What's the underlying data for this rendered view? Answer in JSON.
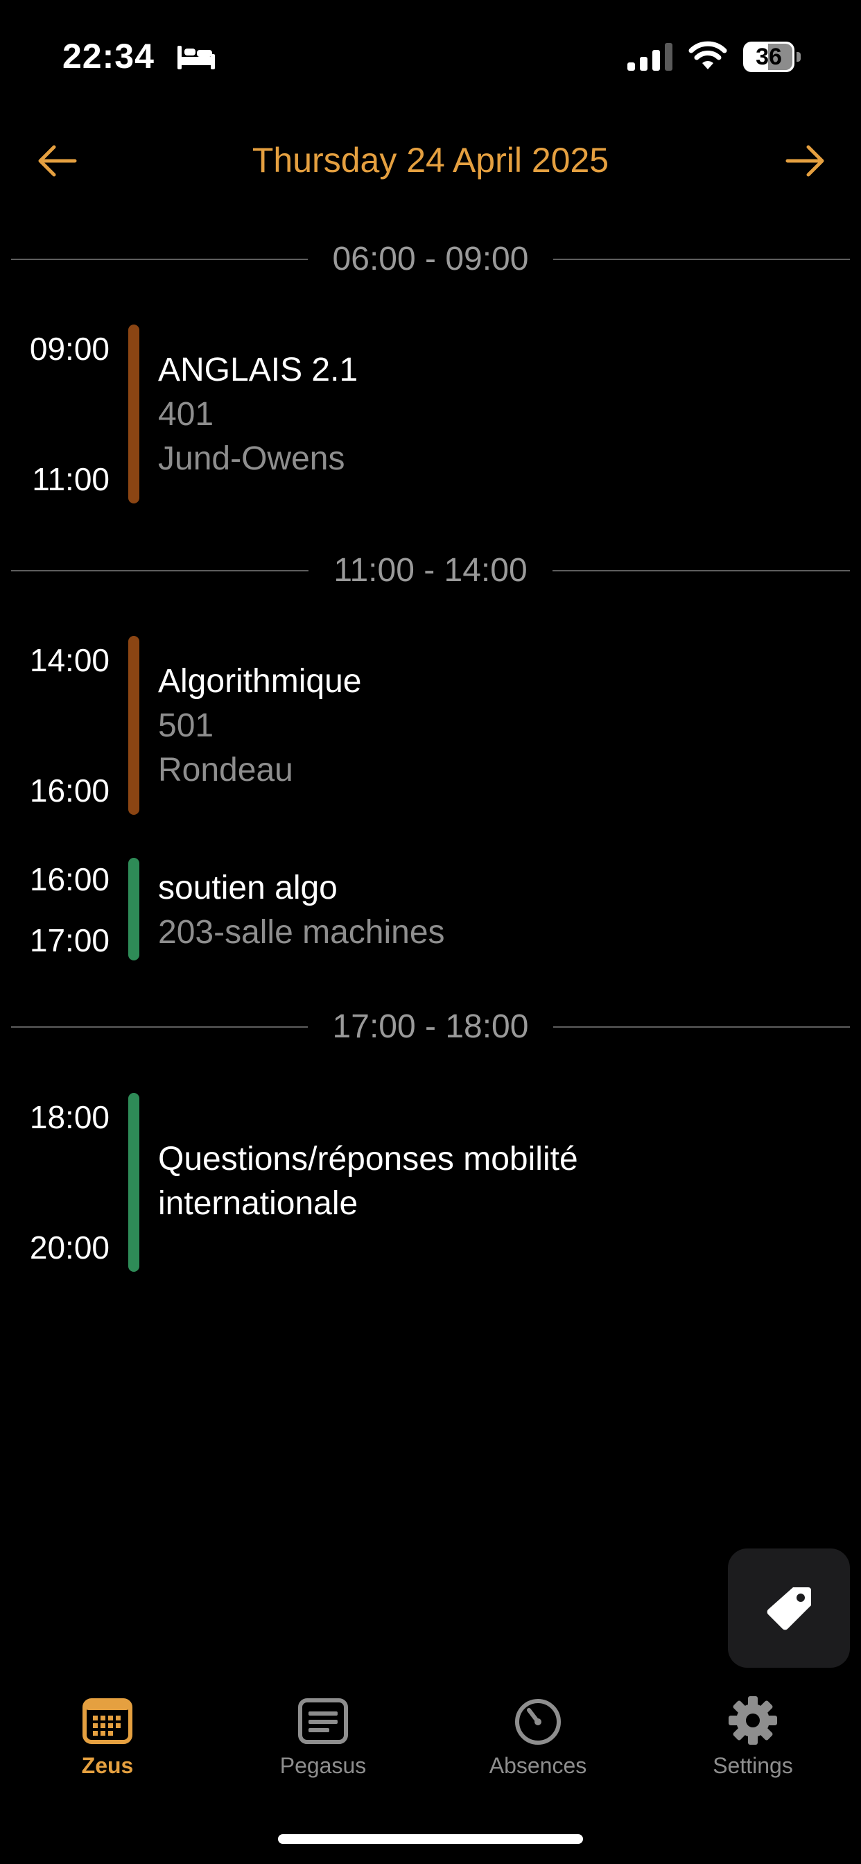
{
  "status_bar": {
    "time": "22:34",
    "battery_level": "36",
    "icons": [
      "bed-icon",
      "signal-icon",
      "wifi-icon",
      "battery-icon"
    ]
  },
  "header": {
    "date": "Thursday 24 April 2025",
    "prev_icon": "arrow-left-icon",
    "next_icon": "arrow-right-icon",
    "accent_color": "#E5A040"
  },
  "schedule": {
    "separators": [
      {
        "label": "06:00 - 09:00"
      },
      {
        "label": "11:00 - 14:00"
      },
      {
        "label": "17:00 - 18:00"
      }
    ],
    "events": [
      {
        "start": "09:00",
        "end": "11:00",
        "title": "ANGLAIS 2.1",
        "room": "401",
        "teacher": "Jund-Owens",
        "color": "#8B4513"
      },
      {
        "start": "14:00",
        "end": "16:00",
        "title": "Algorithmique",
        "room": "501",
        "teacher": "Rondeau",
        "color": "#8B4513"
      },
      {
        "start": "16:00",
        "end": "17:00",
        "title": "soutien algo",
        "room": "203-salle machines",
        "color": "#2E8B57"
      },
      {
        "start": "18:00",
        "end": "20:00",
        "title_line1": "Questions/réponses mobilité",
        "title_line2": "internationale",
        "color": "#2E8B57"
      }
    ]
  },
  "fab": {
    "icon": "tag-icon"
  },
  "tab_bar": {
    "tabs": [
      {
        "label": "Zeus",
        "icon": "calendar-icon",
        "active": true
      },
      {
        "label": "Pegasus",
        "icon": "document-icon",
        "active": false
      },
      {
        "label": "Absences",
        "icon": "timer-icon",
        "active": false
      },
      {
        "label": "Settings",
        "icon": "gear-icon",
        "active": false
      }
    ],
    "active_color": "#E5A040",
    "inactive_color": "#8E8E8E"
  }
}
